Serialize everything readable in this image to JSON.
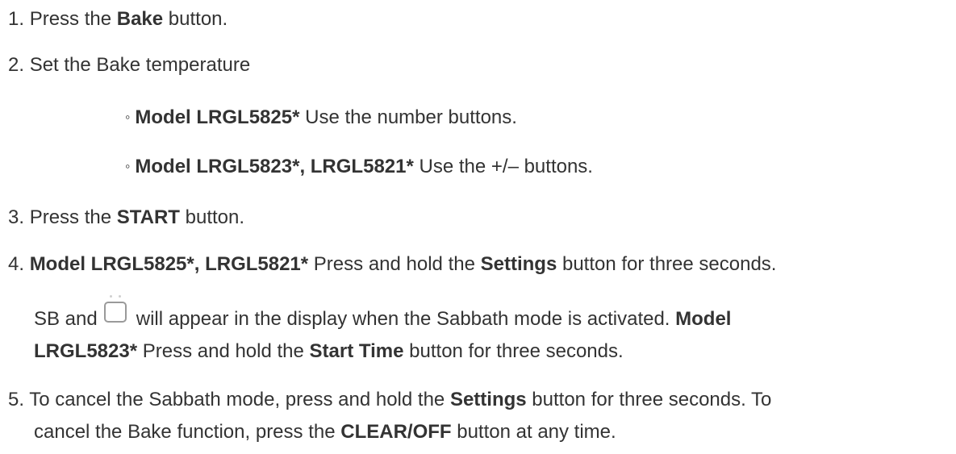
{
  "steps": [
    {
      "num": "1.",
      "pre": "Press the",
      "bold": "Bake",
      "post": "button."
    },
    {
      "num": "2.",
      "text": "Set the Bake temperature",
      "subitems": [
        {
          "bullet": "◦",
          "bold": "Model LRGL5825*",
          "text": "Use the number buttons."
        },
        {
          "bullet": "◦",
          "bold": "Model LRGL5823*, LRGL5821*",
          "text": "Use the +/– buttons."
        }
      ]
    },
    {
      "num": "3.",
      "pre": "Press the",
      "bold": "START",
      "post": "button."
    },
    {
      "num": "4.",
      "bold1": "Model LRGL5825*, LRGL5821*",
      "text1": "Press and hold the",
      "bold2": "Settings",
      "text2": "button for three seconds.",
      "sb_pre": "SB and",
      "sb_post": "will appear in the display when the Sabbath mode is activated.",
      "bold3a": "Model",
      "bold3b": "LRGL5823*",
      "text3": "Press and hold the",
      "bold4": "Start Time",
      "text4": "button for three seconds.",
      "icon": "sabbath-mode-icon"
    },
    {
      "num": "5.",
      "text1": "To cancel the Sabbath mode, press and hold the",
      "bold1": "Settings",
      "text2": "button for three seconds. To",
      "text3": "cancel the Bake function, press the",
      "bold2": "CLEAR/OFF",
      "text4": "button at any time."
    }
  ]
}
